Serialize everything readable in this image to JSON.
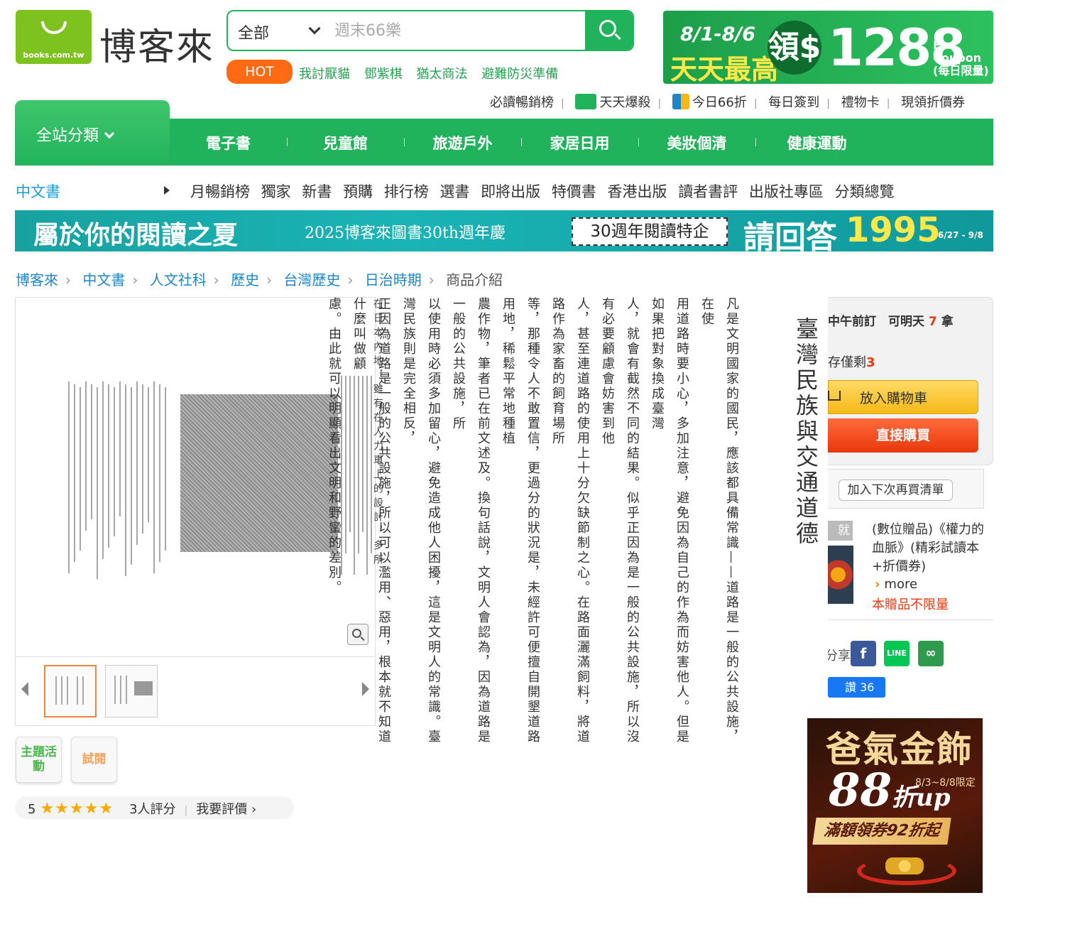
{
  "header": {
    "logo_domain": "books.com.tw",
    "logo_text": "博客來",
    "search": {
      "category": "全部",
      "placeholder": "週末66樂"
    },
    "hot_label": "HOT",
    "hot_links": [
      "我討厭貓",
      "鄧紫棋",
      "猶太商法",
      "避難防災準備"
    ],
    "promo_banner": {
      "date": "8/1-8/6",
      "tagline": "天天最高",
      "claim": "領$",
      "amount": "1288",
      "coupon_label": "E-Coupon",
      "coupon_note": "(每日限量)"
    },
    "top_links": [
      "必讀暢銷榜",
      "天天爆殺",
      "今日66折",
      "每日簽到",
      "禮物卡",
      "現領折價券"
    ]
  },
  "nav": {
    "all_categories": "全站分類",
    "items": [
      "電子書",
      "兒童館",
      "旅遊戶外",
      "家居日用",
      "美妝個清",
      "健康運動"
    ]
  },
  "subnav": {
    "current": "中文書",
    "links": [
      "月暢銷榜",
      "獨家",
      "新書",
      "預購",
      "排行榜",
      "選書",
      "即將出版",
      "特價書",
      "香港出版",
      "讀者書評",
      "出版社專區",
      "分類總覽"
    ]
  },
  "mid_banner": {
    "title": "屬於你的閱讀之夏",
    "subtitle": "2025博客來圖書30th週年慶",
    "box_text": "30週年閱讀特企",
    "answer_text": "請回答",
    "number": "1995",
    "date": "6/27 - 9/8"
  },
  "breadcrumb": [
    "博客來",
    "中文書",
    "人文社科",
    "歷史",
    "台灣歷史",
    "日治時期",
    "商品介紹"
  ],
  "preview": {
    "side_buttons": [
      "主題活動",
      "試閱"
    ]
  },
  "rating": {
    "score": "5",
    "stars": "★★★★★",
    "count": "3人評分",
    "write_review": "我要評價 ›"
  },
  "book_page": {
    "title": "臺灣民族與交通道德",
    "margin_text": "在日本內地，雖有在人力車上的設計，多所",
    "columns": [
      "凡是文明國家的國民，應該都具備常識——道路是一般的公共設施，在使",
      "用道路時要小心，多加注意，避免因為自己的作為而妨害他人。但是如果把對象換成臺灣",
      "人，就會有截然不同的結果。似乎正因為是一般的公共設施，所以沒有必要顧慮會妨害到他",
      "人，甚至連道路的使用上十分欠缺節制之心。在路面灑滿飼料，將道路作為家畜的飼育場所",
      "等，那種令人不敢置信，更過分的狀況是，未經許可便擅自開墾道路用地，稀鬆平常地種植",
      "農作物，筆者已在前文述及。換句話說，文明人會認為，因為道路是一般的公共設施，所",
      "以使用時必須多加留心，避免造成他人困擾，這是文明人的常識。臺灣民族則是完全相反，",
      "正因為道路是一般的公共設施，所以可以濫用、惡用，根本就不知道什麼叫做顧",
      "慮。由此就可以明顯看出文明和野蠻的差別。"
    ]
  },
  "purchase": {
    "delivery": "中午前訂　可明天",
    "delivery_tail": "拿",
    "stock_label": "存僅剩",
    "stock_count": "3",
    "add_to_cart": "放入購物車",
    "buy_now": "直接購買",
    "wishlist": "加入下次再買清單",
    "gift_tag": "就送",
    "gift_text": "(數位贈品)《權力的血脈》(精彩試讀本+折價券)",
    "gift_more": "more",
    "gift_limit": "本贈品不限量",
    "share_label": "分享",
    "like_label": "讚 36"
  },
  "side_ad": {
    "title": "爸氣金飾",
    "discount": "88",
    "discount_unit": "折up",
    "date_note": "8/3~8/8限定",
    "coupon": "滿額領券92折起"
  },
  "colors": {
    "brand_green": "#21b35b",
    "hot_orange": "#ff6a13",
    "link_blue": "#1e86c8",
    "buy_red": "#e8380d",
    "cart_yellow": "#f6b817"
  }
}
